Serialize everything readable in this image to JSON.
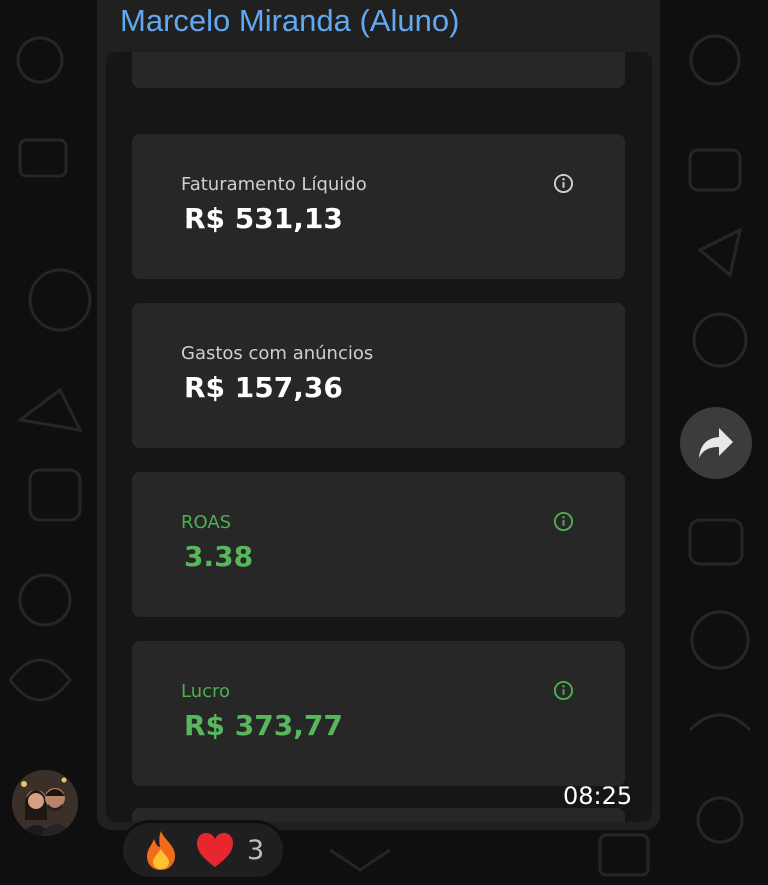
{
  "message": {
    "sender": "Marcelo Miranda (Aluno)",
    "time": "08:25"
  },
  "cards": [
    {
      "label": "Faturamento Líquido",
      "value": "R$ 531,13",
      "icon": "info-icon"
    },
    {
      "label": "Gastos com anúncios",
      "value": "R$ 157,36"
    },
    {
      "label": "ROAS",
      "value": "3.38",
      "icon": "info-icon"
    },
    {
      "label": "Lucro",
      "value": "R$ 373,77",
      "icon": "info-icon"
    }
  ],
  "reactions": {
    "emojis": [
      "fire-emoji",
      "red-heart-emoji"
    ],
    "count": "3"
  },
  "colors": {
    "sender_name": "#62a8f0",
    "positive_metric": "#58b75c",
    "bubble": "#202020",
    "card": "#272727"
  }
}
